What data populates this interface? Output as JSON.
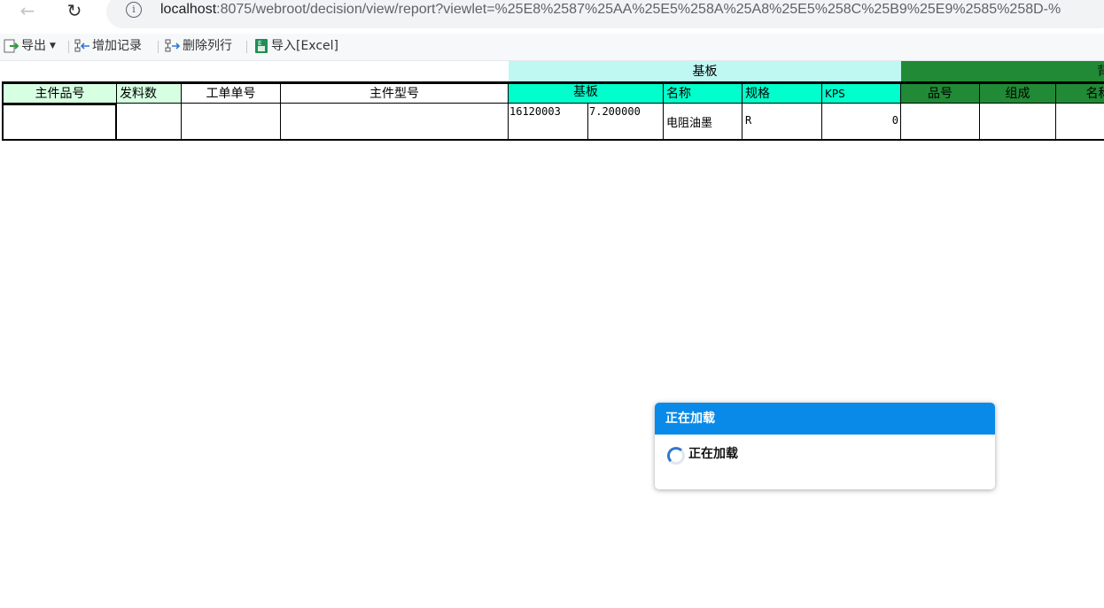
{
  "browser": {
    "url_host": "localhost",
    "url_rest": ":8075/webroot/decision/view/report?viewlet=%25E8%2587%25AA%25E5%258A%25A8%25E5%258C%25B9%25E9%2585%258D-%"
  },
  "toolbar": {
    "export_label": "导出",
    "add_record_label": "增加记录",
    "delete_row_label": "删除列行",
    "import_excel_label": "导入[Excel]"
  },
  "report": {
    "group_headers": [
      "基板",
      "背"
    ],
    "columns": [
      "主件品号",
      "发料数",
      "工单单号",
      "主件型号",
      "基板",
      "名称",
      "规格",
      "KPS",
      "品号",
      "组成",
      "名称"
    ],
    "row": {
      "main_part_no": "",
      "issue_qty": "",
      "work_order_no": "",
      "main_model": "",
      "substrate_code": "16120003",
      "substrate_qty": "7.200000",
      "name": "电阻油墨",
      "spec": "R",
      "kps": "0",
      "back_part_no": "",
      "back_composition": "",
      "back_name": ""
    }
  },
  "loading_dialog": {
    "title": "正在加载",
    "message": "正在加载"
  },
  "colors": {
    "group_substrate_bg": "#bff7f3",
    "group_back_bg": "#218a36",
    "col_main_bg": "#d7ffe2",
    "col_substrate_bg": "#00ffcc",
    "dialog_header_bg": "#0a8ae8"
  }
}
